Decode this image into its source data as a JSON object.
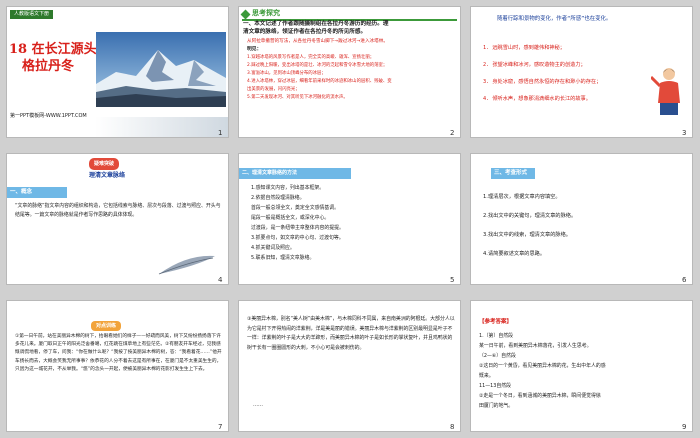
{
  "slides": [
    {
      "num": "1",
      "badge": "人教版语文下册",
      "title_line1": "18 在长江源头",
      "title_line2": "格拉丹冬",
      "footer": "第一PPT模板网-WWW.1PPT.COM"
    },
    {
      "num": "2",
      "header": "思考探究",
      "question_line1": "一、本文记述了作者跟随摄制组在各拉丹冬游历的经历。理",
      "question_line2": "清文章的脉络，领证作者在各拉丹冬的所见所感。",
      "route": "从阿拉草撤营的写法，从各拉丹冬雪山脚下→跋过冰河→进入冰塔林。",
      "answer_label": "明见：",
      "lines": [
        "1.穿越冰塔的风景写作者是人，完全实的高峻、雄浑、宣扬壮丽；",
        "2.踩过晚上阳暖，变出冰塔的是壮、冰河的泛起和雪令冰雪大地的荡室；",
        "3.富溢冰山，见到冰山顶峰分布的冰层；",
        "4.进入冰塔林，穿过冰层，细看年前采样时的冰迹和冰山的层积、残破、变",
        "  出美景的发展，闪闪亮光；",
        "5.第二天发现冰河、对其听见下冰河融化的流水声。"
      ]
    },
    {
      "num": "3",
      "header": "随着行踪和景物的变化，作者“所感”也在变化。",
      "lines": [
        "1. 远眺雪山时，感到雄伟和神秘；",
        "2. 张望冰峰和冰河，感叹造物主的创造力；",
        "3. 身处冰窟，感悟自然永恒的存在和渺小的存在；",
        "4. 倾听水声，想象那涓滴细水的长江的故事。"
      ]
    },
    {
      "num": "4",
      "tag_top": "疑难",
      "tag_mid": "突破",
      "subtitle": "理清文章脉络",
      "section": "一、概念",
      "paragraph": "“文章的脉络”指文章内容的组织和构造，它包括线索与脉络、层次与段落、过渡与照应、开头与结尾等。一篇文章的脉络就是作者写作思路的具体体现。"
    },
    {
      "num": "5",
      "section": "二、理清文章脉络的方法",
      "lines": [
        "1.感知课文内容，列出基本框架。",
        "2.依据自然段理清脉络。",
        "  首段一般总领全文，奠定全文感情基调。",
        "  尾段一般是概括全文，或深化中心。",
        "  过渡段，是一条纽带主章整体内容的提提。",
        "3.抓要点句，如文章的中心句、过渡句等。",
        "4.抓关键词及照应。",
        "5.联系旧知，理清文章脉络。"
      ]
    },
    {
      "num": "6",
      "section": "三、考查形式",
      "lines": [
        "1.理清层次，根据文章内容填空。",
        "2.找出文中的关键句，理清文章的脉络。",
        "3.找出文中的线索，理清文章的脉络。",
        "4.请简要叙述文章的思路。"
      ]
    },
    {
      "num": "7",
      "tag": "对点训练",
      "paragraph": "①第一日午前，站在美丽异木棉的树下，抬眼看她们的样子——好疏而风美，树下又纷纷扬扬落下许多花儿来。厦门取日正午的阳光泛舍番噶，红花跳在煤草地上有些茫茫。②有朋友开车经过，见我感慨调侃地看，停了车，问我：“你在做什么呢？“我按了按美丽异木棉的树，答：“我看着花……”他开车扬长而去，大概会笑我无所事事？依恭花的人分不着去这是有所事在，在厦门是不太重美生生的，只因为这一城花开，不从举我。“悠”的念头一开起，便被美丽异木棉的花影打发生生上下去。"
    },
    {
      "num": "8",
      "paragraph": "③美丽异木棉，别名“美人树”由美木棉”，与木棉同科不同属，来自南美洲的阿根廷。大部分人以为它是村下开得热闹的洋紫荆，洋是美是丽的错误。美丽异木棉与洋紫荆的区别最明显是叶子不一样：洋紫荆的叶子是大大的羊蹄形，而美丽异木棉的叶子是如长形的掌状复叶，并且鸡鸭状的树干长有一圈圈圆形的大刺，不小心可是会被刺伤的。",
      "ellipsis": "……"
    },
    {
      "num": "9",
      "header": "【参考答案】",
      "lines": [
        "1.（第）自然段",
        "某一日午前，看到美丽异木棉落花，引发人生思考。",
        "（2—⑥）自然段",
        "②这日的一个黄昏，看见美丽异木棉的花，生出中年人的感",
        "慨来。",
        "11—13自然段",
        "②走是一个冬日，看到涵城的美丽异木棉，瞬间便觉得徐",
        "田厦门的地气。"
      ]
    }
  ]
}
